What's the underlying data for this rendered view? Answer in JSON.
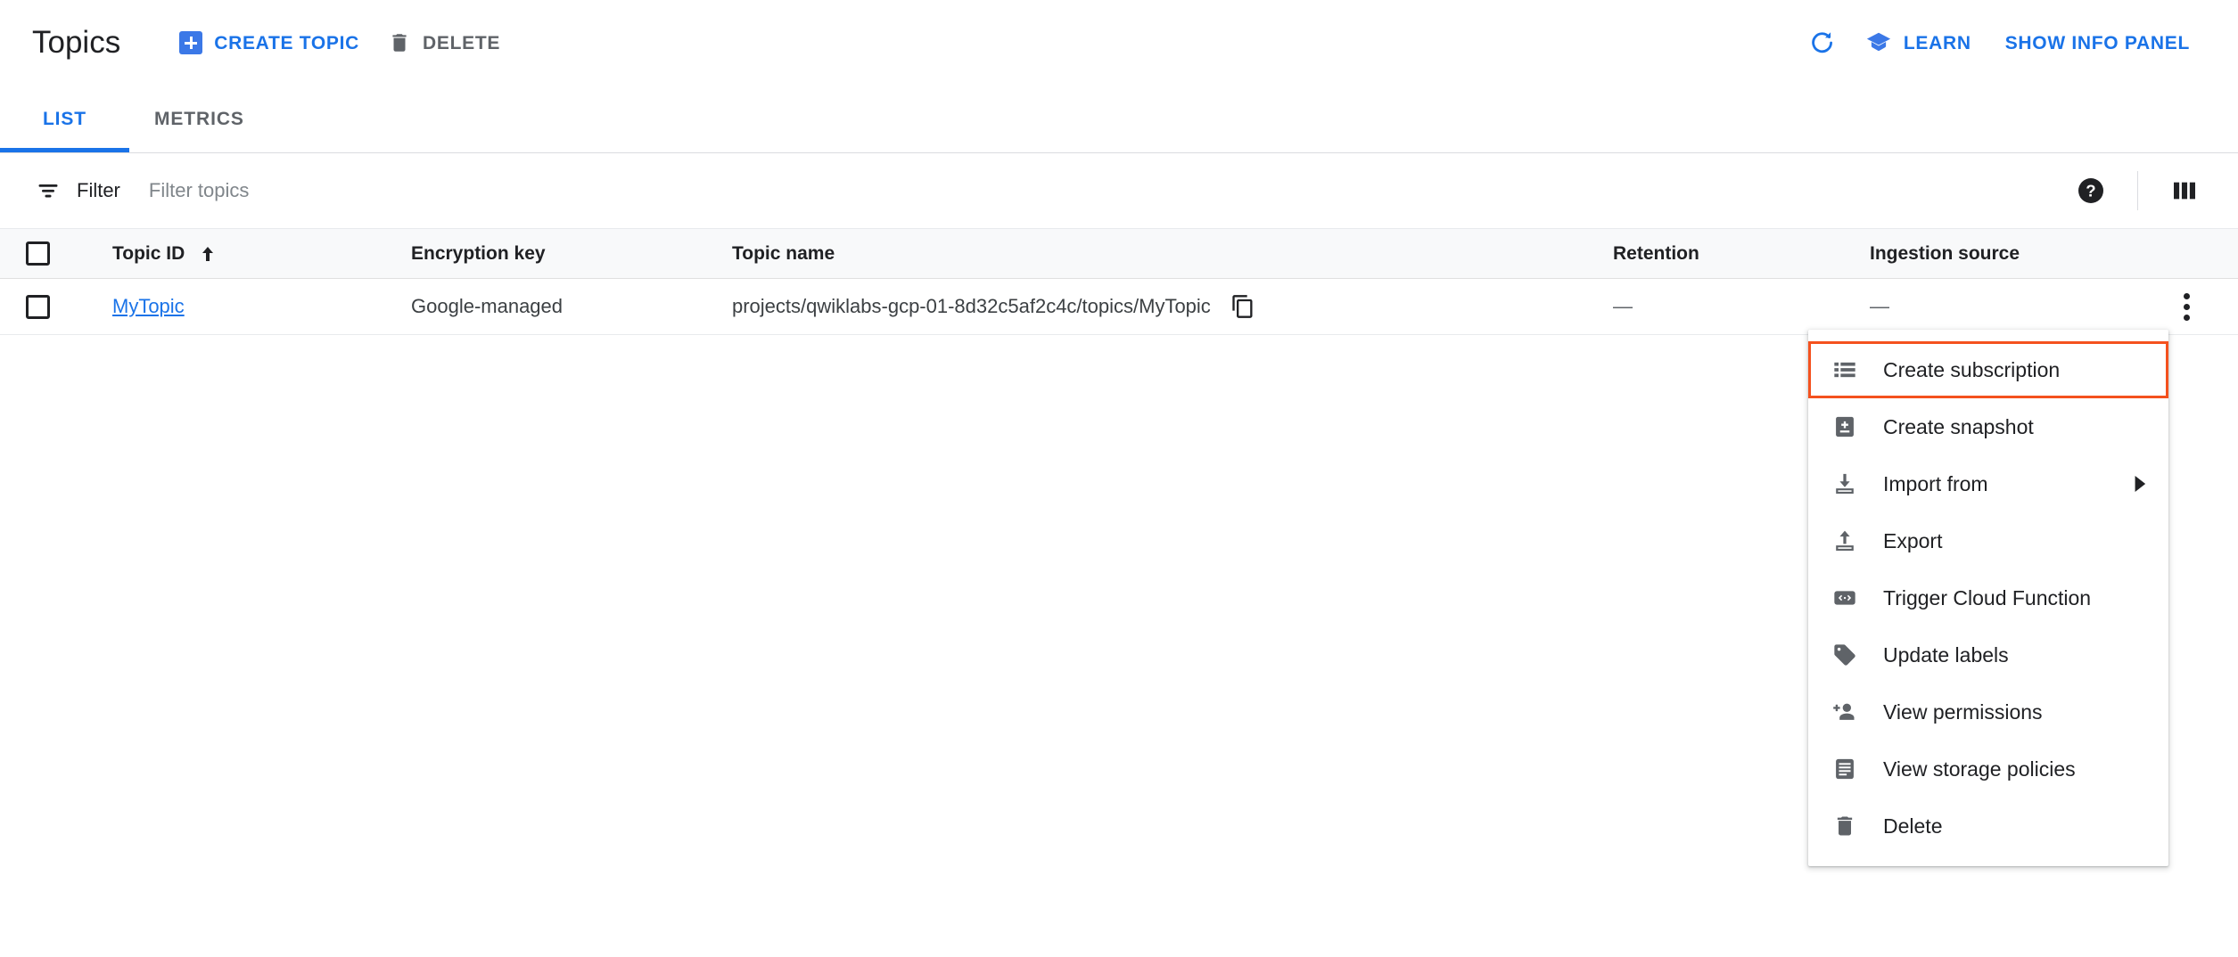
{
  "header": {
    "title": "Topics",
    "actions": [
      {
        "label": "CREATE TOPIC",
        "icon": "plus-square-icon",
        "state": "enabled"
      },
      {
        "label": "DELETE",
        "icon": "trash-icon",
        "state": "disabled"
      }
    ],
    "right": [
      {
        "label": "",
        "icon": "refresh-icon"
      },
      {
        "label": "LEARN",
        "icon": "graduation-cap-icon"
      },
      {
        "label": "SHOW INFO PANEL",
        "icon": ""
      }
    ],
    "refresh_icon": "refresh-icon",
    "learn_label": "LEARN",
    "info_panel_label": "SHOW INFO PANEL"
  },
  "tabs": [
    {
      "label": "LIST",
      "active": true
    },
    {
      "label": "METRICS",
      "active": false
    }
  ],
  "filter": {
    "icon": "filter-icon",
    "label": "Filter",
    "placeholder": "Filter topics",
    "value": "",
    "help_icon": "help-icon",
    "columns_icon": "column-display-options-icon"
  },
  "table": {
    "columns": [
      "Topic ID",
      "Encryption key",
      "Topic name",
      "Retention",
      "Ingestion source"
    ],
    "sort_column": "Topic ID",
    "sort_direction": "ascending",
    "rows": [
      {
        "selected": false,
        "topic_id": "MyTopic",
        "encryption_key": "Google-managed",
        "topic_name": "projects/qwiklabs-gcp-01-8d32c5af2c4c/topics/MyTopic",
        "retention": "—",
        "ingestion_source": "—"
      }
    ]
  },
  "menu": {
    "items": [
      {
        "label": "Create subscription",
        "icon": "list-icon",
        "highlighted": true,
        "submenu": false
      },
      {
        "label": "Create snapshot",
        "icon": "snapshot-icon",
        "highlighted": false,
        "submenu": false
      },
      {
        "label": "Import from",
        "icon": "import-download-icon",
        "highlighted": false,
        "submenu": true
      },
      {
        "label": "Export",
        "icon": "export-upload-icon",
        "highlighted": false,
        "submenu": false
      },
      {
        "label": "Trigger Cloud Function",
        "icon": "code-brackets-icon",
        "highlighted": false,
        "submenu": false
      },
      {
        "label": "Update labels",
        "icon": "tag-icon",
        "highlighted": false,
        "submenu": false
      },
      {
        "label": "View permissions",
        "icon": "person-add-icon",
        "highlighted": false,
        "submenu": false
      },
      {
        "label": "View storage policies",
        "icon": "document-lines-icon",
        "highlighted": false,
        "submenu": false
      },
      {
        "label": "Delete",
        "icon": "trash-icon",
        "highlighted": false,
        "submenu": false
      }
    ]
  },
  "colors": {
    "accent_blue": "#1a73e8",
    "create_icon_blue": "#3b78e7",
    "highlight_orange": "#f4511e",
    "text_primary": "#202124",
    "text_secondary": "#5f6368",
    "header_row_bg": "#f8f9fa",
    "divider": "#dadce0"
  }
}
